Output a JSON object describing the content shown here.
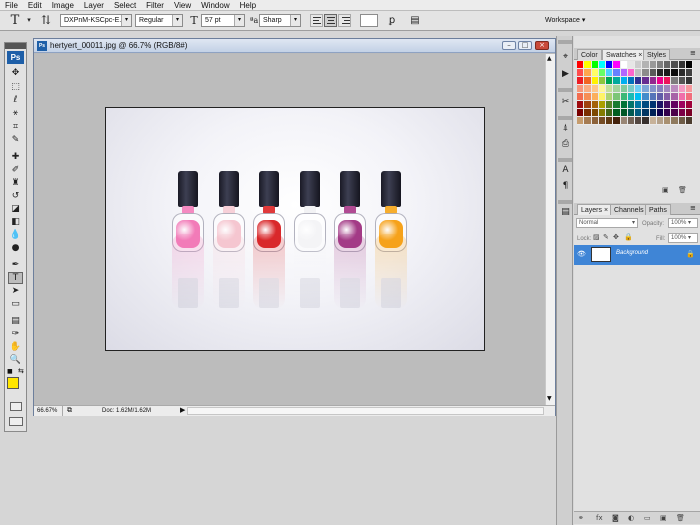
{
  "menu": [
    "File",
    "Edit",
    "Image",
    "Layer",
    "Select",
    "Filter",
    "View",
    "Window",
    "Help"
  ],
  "options": {
    "tool_icon": "type-tool-icon",
    "font_family": "DXPnM-KSCpc-E...",
    "font_style": "Regular",
    "font_size": "57 pt",
    "antialias": "Sharp",
    "workspace": "Workspace"
  },
  "tools": [
    "move",
    "marquee",
    "lasso",
    "magic-wand",
    "crop",
    "slice",
    "healing",
    "brush",
    "clone-stamp",
    "history-brush",
    "eraser",
    "gradient",
    "blur",
    "dodge",
    "pen",
    "type",
    "path-selection",
    "rectangle",
    "notes",
    "eyedropper",
    "hand",
    "zoom"
  ],
  "colors": {
    "foreground": "#ffe600",
    "background": "#ffffff",
    "selection": "#3f85d6"
  },
  "document": {
    "title": "hertyert_00011.jpg @ 66.7% (RGB/8#)",
    "zoom": "66.67%",
    "doc_info": "Doc: 1.62M/1.62M"
  },
  "bottles": [
    {
      "color": "#f27bb8",
      "neck": "#f58ac1"
    },
    {
      "color": "#f5c6d0",
      "neck": "#f7d0d8"
    },
    {
      "color": "#d9282b",
      "neck": "#e0393a"
    },
    {
      "color": "#f4f4f6",
      "neck": "#f2f2f4"
    },
    {
      "color": "#a33a86",
      "neck": "#b14b93"
    },
    {
      "color": "#f6a21a",
      "neck": "#f7ae2e"
    }
  ],
  "swatch_panel": {
    "tabs": [
      "Color",
      "Swatches",
      "Styles"
    ],
    "active_tab": "Swatches"
  },
  "swatches": [
    "#ff0000",
    "#ffff00",
    "#00ff00",
    "#00ffff",
    "#0000ff",
    "#ff00ff",
    "#ffffff",
    "#e6e6e6",
    "#cccccc",
    "#b3b3b3",
    "#999999",
    "#808080",
    "#666666",
    "#4d4d4d",
    "#333333",
    "#000000",
    "#ff4d4d",
    "#ffa64d",
    "#ffff66",
    "#66ff66",
    "#4dd2ff",
    "#6680ff",
    "#b366ff",
    "#ff66cc",
    "#c0c0c0",
    "#8c8c8c",
    "#595959",
    "#262626",
    "#1a1a1a",
    "#0d0d0d",
    "#2b2b2b",
    "#404040",
    "#ed1c24",
    "#f26522",
    "#fff200",
    "#8dc63f",
    "#00a651",
    "#00a99d",
    "#00aeef",
    "#0072bc",
    "#2e3192",
    "#662d91",
    "#92278f",
    "#ec008c",
    "#ed145b",
    "#7d7d7d",
    "#555555",
    "#353535",
    "#f7977a",
    "#f9ad81",
    "#fdc68a",
    "#fff79a",
    "#c4df9b",
    "#a3d39c",
    "#82ca9d",
    "#7bcdc8",
    "#6ecff6",
    "#7ea7d8",
    "#8493ca",
    "#8882be",
    "#a187be",
    "#bc8dbf",
    "#f49ac2",
    "#f6989d",
    "#f26c4f",
    "#f68e55",
    "#fbaf5c",
    "#fff467",
    "#acd372",
    "#7cc576",
    "#3bb878",
    "#1abbb4",
    "#00bff3",
    "#438ccb",
    "#5574b9",
    "#605ca8",
    "#855fa8",
    "#a763a8",
    "#f06eaa",
    "#f26d7d",
    "#9e0b0f",
    "#a0410d",
    "#a36209",
    "#aba000",
    "#598527",
    "#1a7b30",
    "#007236",
    "#00746b",
    "#0076a3",
    "#004b80",
    "#003471",
    "#1b1464",
    "#440e62",
    "#630460",
    "#9e005d",
    "#9e0039",
    "#790000",
    "#7b2e00",
    "#7d4900",
    "#827b00",
    "#406618",
    "#005e20",
    "#005826",
    "#005952",
    "#005b7f",
    "#003663",
    "#002157",
    "#0d004c",
    "#32004b",
    "#4b0049",
    "#7b0046",
    "#7a0026",
    "#c69c6d",
    "#a67c52",
    "#8c6239",
    "#754c24",
    "#603913",
    "#42210b",
    "#998675",
    "#736357",
    "#534741",
    "#362f2d",
    "#c7b299",
    "#b4a18a",
    "#a89070",
    "#8f7a5e",
    "#6e5c47",
    "#4b3d2f"
  ],
  "layers_panel": {
    "tabs": [
      "Layers",
      "Channels",
      "Paths"
    ],
    "active_tab": "Layers",
    "blend_mode": "Normal",
    "opacity_label": "Opacity:",
    "opacity": "100%",
    "lock_label": "Lock:",
    "fill_label": "Fill:",
    "fill": "100%",
    "layer_name": "Background"
  }
}
